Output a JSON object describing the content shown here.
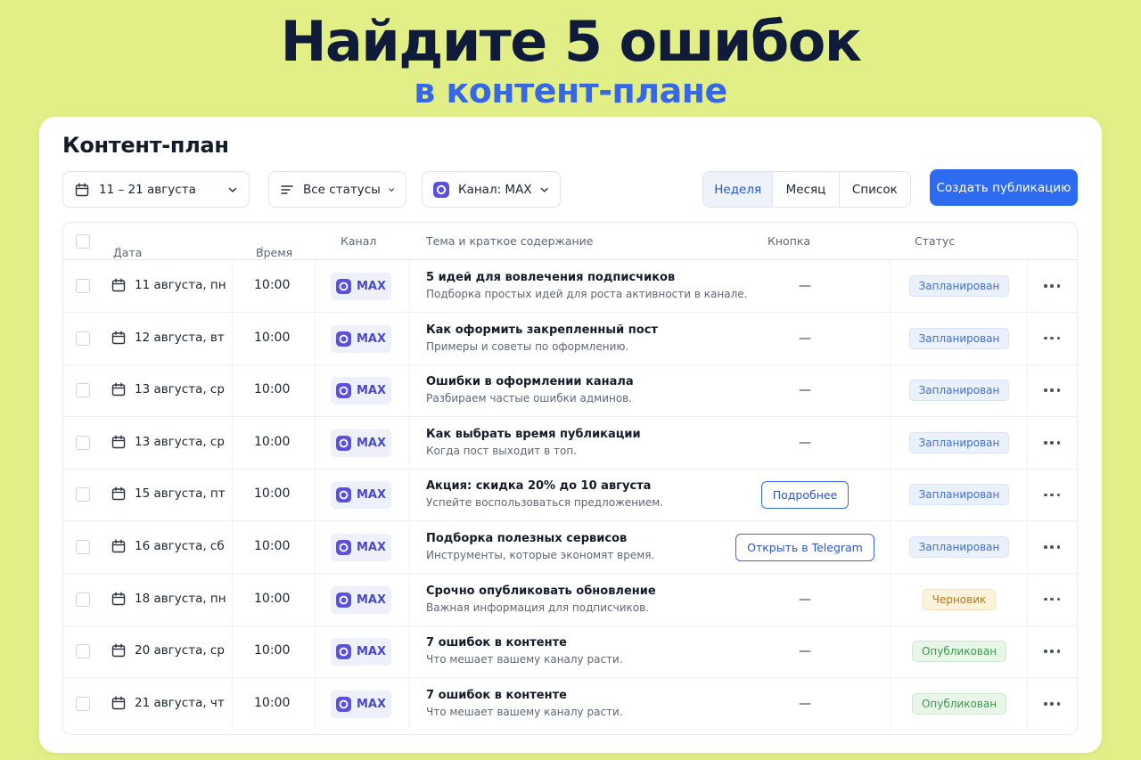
{
  "headline": "Найдите 5 ошибок",
  "subheadline": "в контент-плане",
  "card": {
    "title": "Контент-план",
    "filters": {
      "date_range": "11 – 21 августа",
      "status": "Все статусы",
      "channel": "Канал: MAX"
    },
    "view_tabs": [
      "Неделя",
      "Месяц",
      "Список"
    ],
    "active_tab": "Неделя",
    "create_button": "Создать публикацию"
  },
  "table": {
    "headers": {
      "date": "Дата",
      "time": "Время",
      "channel": "Канал",
      "topic": "Тема и краткое содержание",
      "button": "Кнопка",
      "status": "Статус"
    },
    "rows": [
      {
        "date": "11 августа, пн",
        "time": "10:00",
        "channel": "MAX",
        "title": "5 идей для вовлечения подписчиков",
        "desc": "Подборка простых идей для роста активности в канале.",
        "button": "—",
        "status": "Запланирован",
        "status_kind": "planned"
      },
      {
        "date": "12 августа, вт",
        "time": "10:00",
        "channel": "MAX",
        "title": "Как оформить закрепленный пост",
        "desc": "Примеры и советы по оформлению.",
        "button": "—",
        "status": "Запланирован",
        "status_kind": "planned"
      },
      {
        "date": "13 августа, ср",
        "time": "10:00",
        "channel": "MAX",
        "title": "Ошибки в оформлении канала",
        "desc": "Разбираем частые ошибки админов.",
        "button": "—",
        "status": "Запланирован",
        "status_kind": "planned"
      },
      {
        "date": "13 августа, ср",
        "time": "10:00",
        "channel": "MAX",
        "title": "Как выбрать время публикации",
        "desc": "Когда пост выходит в топ.",
        "button": "—",
        "status": "Запланирован",
        "status_kind": "planned"
      },
      {
        "date": "15 августа, пт",
        "time": "10:00",
        "channel": "MAX",
        "title": "Акция: скидка 20% до 10 августа",
        "desc": "Успейте воспользоваться предложением.",
        "button": "Подробнее",
        "status": "Запланирован",
        "status_kind": "planned"
      },
      {
        "date": "16 августа, сб",
        "time": "10:00",
        "channel": "MAX",
        "title": "Подборка полезных сервисов",
        "desc": "Инструменты, которые экономят время.",
        "button": "Открыть в Telegram",
        "status": "Запланирован",
        "status_kind": "planned"
      },
      {
        "date": "18 августа, пн",
        "time": "10:00",
        "channel": "MAX",
        "title": "Срочно опубликовать обновление",
        "desc": "Важная информация для подписчиков.",
        "button": "—",
        "status": "Черновик",
        "status_kind": "draft"
      },
      {
        "date": "20 августа, ср",
        "time": "10:00",
        "channel": "MAX",
        "title": "7 ошибок в контенте",
        "desc": "Что мешает вашему каналу расти.",
        "button": "—",
        "status": "Опубликован",
        "status_kind": "published"
      },
      {
        "date": "21 августа, чт",
        "time": "10:00",
        "channel": "MAX",
        "title": "7 ошибок в контенте",
        "desc": "Что мешает вашему каналу расти.",
        "button": "—",
        "status": "Опубликован",
        "status_kind": "published"
      }
    ]
  },
  "colors": {
    "background": "#e2ee86",
    "headline": "#101b3a",
    "accent": "#3567e6",
    "primary_button": "#2d6bf0",
    "max_brand": "#4a49c8",
    "status_planned_bg": "#eaf1fd",
    "status_planned_text": "#3f6fd1",
    "status_draft_bg": "#fdf3dc",
    "status_draft_text": "#b5781b",
    "status_published_bg": "#e7f6e8",
    "status_published_text": "#3e9a4c"
  },
  "icons": {
    "date_filter": "calendar-icon",
    "status_filter": "filter-lines-icon",
    "channel_filter": "max-logo-icon",
    "dropdown": "chevron-down-icon",
    "sort": "sort-icon",
    "row_date": "calendar-icon",
    "row_menu": "more-horizontal-icon"
  }
}
